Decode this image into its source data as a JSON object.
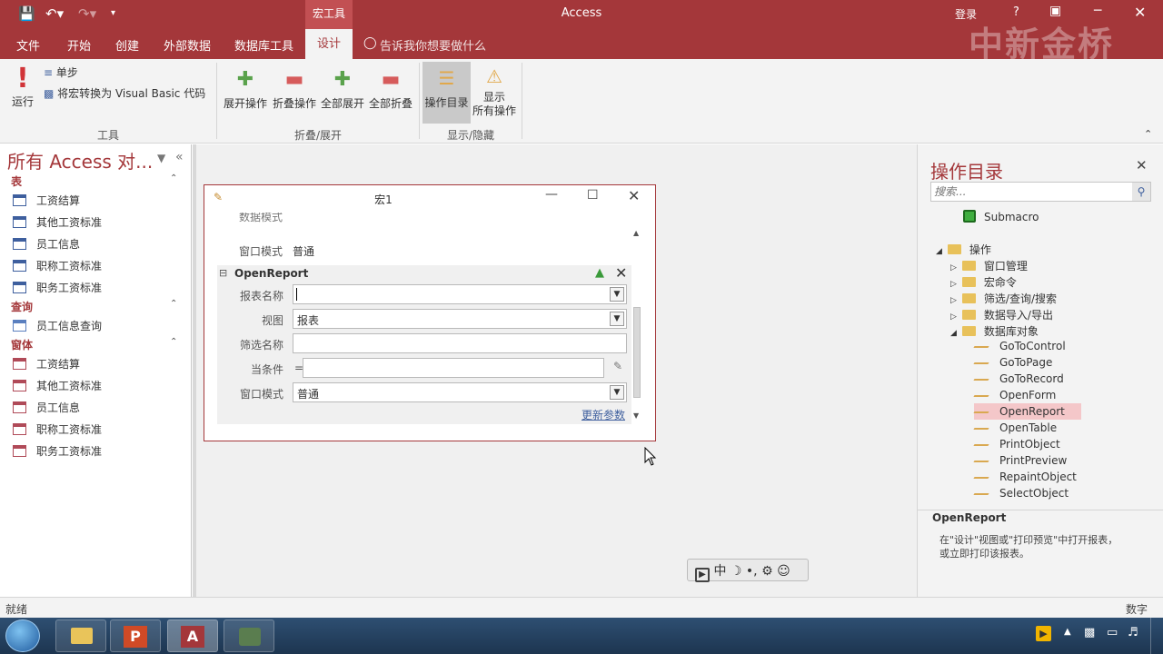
{
  "app": {
    "title": "Access",
    "context_tab": "宏工具",
    "login": "登录",
    "help": "?"
  },
  "tabs": [
    "文件",
    "开始",
    "创建",
    "外部数据",
    "数据库工具",
    "设计"
  ],
  "tell_me": "告诉我你想要做什么",
  "watermark": "中新金桥",
  "ribbon": {
    "run": "运行",
    "single_step": "单步",
    "convert": "将宏转换为 Visual Basic 代码",
    "group_tools": "工具",
    "expand": "展开操作",
    "collapse": "折叠操作",
    "expand_all": "全部展开",
    "collapse_all": "全部折叠",
    "group_fold": "折叠/展开",
    "catalog": "操作目录",
    "show_all_1": "显示",
    "show_all_2": "所有操作",
    "group_show": "显示/隐藏"
  },
  "nav": {
    "title": "所有 Access 对...",
    "sections": [
      {
        "name": "表",
        "items": [
          "工资结算",
          "其他工资标准",
          "员工信息",
          "职称工资标准",
          "职务工资标准"
        ]
      },
      {
        "name": "查询",
        "items": [
          "员工信息查询"
        ]
      },
      {
        "name": "窗体",
        "items": [
          "工资结算",
          "其他工资标准",
          "员工信息",
          "职称工资标准",
          "职务工资标准"
        ]
      }
    ]
  },
  "macro": {
    "window_title": "宏1",
    "clipped_label": "数据模式",
    "prev_label": "窗口模式",
    "prev_value": "普通",
    "action": "OpenReport",
    "fields": [
      {
        "label": "报表名称",
        "value": "",
        "dropdown": true
      },
      {
        "label": "视图",
        "value": "报表",
        "dropdown": true
      },
      {
        "label": "筛选名称",
        "value": "",
        "dropdown": false
      },
      {
        "label": "当条件",
        "value": "",
        "prefix": "=",
        "builder": true
      },
      {
        "label": "窗口模式",
        "value": "普通",
        "dropdown": true
      }
    ],
    "update_params": "更新参数"
  },
  "catalog": {
    "title": "操作目录",
    "search_placeholder": "搜索...",
    "submacro": "Submacro",
    "root": "操作",
    "folders": [
      "窗口管理",
      "宏命令",
      "筛选/查询/搜索",
      "数据导入/导出",
      "数据库对象"
    ],
    "actions": [
      "GoToControl",
      "GoToPage",
      "GoToRecord",
      "OpenForm",
      "OpenReport",
      "OpenTable",
      "PrintObject",
      "PrintPreview",
      "RepaintObject",
      "SelectObject"
    ],
    "selected": "OpenReport",
    "desc_title": "OpenReport",
    "desc_line1": "在\"设计\"视图或\"打印预览\"中打开报表，",
    "desc_line2": "或立即打印该报表。"
  },
  "ime": {
    "mode": "中",
    "punct": "•,"
  },
  "status": {
    "left": "就绪",
    "right": "数字"
  },
  "colors": {
    "accent": "#a4373a",
    "selected": "#f4c7c9"
  }
}
